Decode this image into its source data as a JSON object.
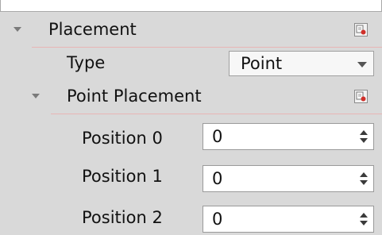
{
  "properties": {
    "placement": {
      "label": "Placement",
      "expanded": true,
      "type": {
        "label": "Type",
        "value": "Point"
      },
      "point_placement": {
        "label": "Point Placement",
        "expanded": true,
        "positions": [
          {
            "label": "Position 0",
            "value": "0"
          },
          {
            "label": "Position 1",
            "value": "0"
          },
          {
            "label": "Position 2",
            "value": "0"
          }
        ]
      }
    }
  },
  "colors": {
    "panel_bg": "#d9d9d9",
    "section_underline": "#e8b5b5",
    "reset_icon_red": "#d0302a"
  },
  "icons": {
    "expand": "triangle-down-icon",
    "reset": "reset-default-icon",
    "dropdown": "chevron-down-icon",
    "spin_up": "spin-up-icon",
    "spin_down": "spin-down-icon"
  }
}
